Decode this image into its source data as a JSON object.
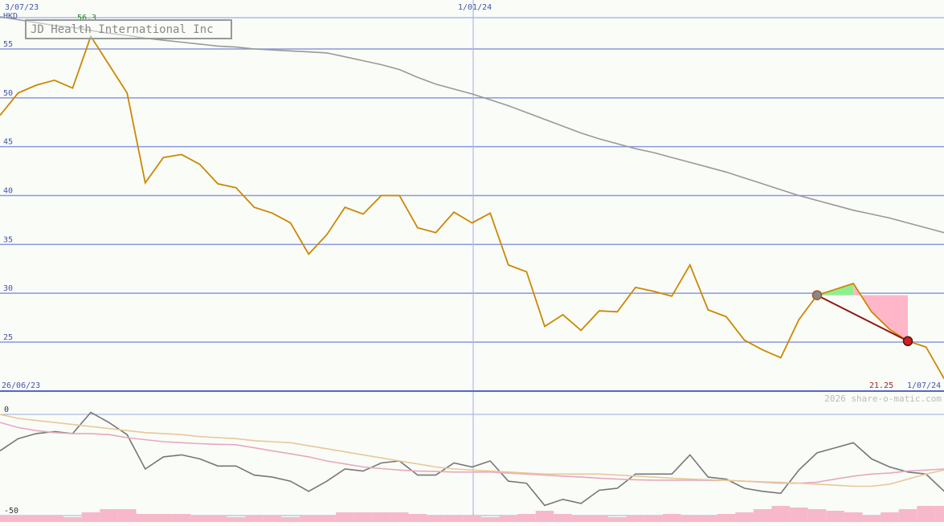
{
  "chart_data": [
    {
      "type": "line",
      "title": "JD Health International Inc",
      "currency_label": "HKD",
      "date_labels": {
        "top_left": "3/07/23",
        "top_mid": "1/01/24",
        "bottom_left": "26/06/23",
        "bottom_right": "1/07/24"
      },
      "y_ticks": [
        "25",
        "30",
        "35",
        "40",
        "45",
        "50",
        "55"
      ],
      "ylim": [
        20,
        58.5
      ],
      "grid": true,
      "max_label": "56.3",
      "min_label": "21.25",
      "x": [
        "2023-06-26",
        "2023-07-03",
        "2023-07-10",
        "2023-07-17",
        "2023-07-24",
        "2023-07-31",
        "2023-08-07",
        "2023-08-14",
        "2023-08-21",
        "2023-08-28",
        "2023-09-04",
        "2023-09-11",
        "2023-09-18",
        "2023-09-25",
        "2023-10-02",
        "2023-10-09",
        "2023-10-16",
        "2023-10-23",
        "2023-10-30",
        "2023-11-06",
        "2023-11-13",
        "2023-11-20",
        "2023-11-27",
        "2023-12-04",
        "2023-12-11",
        "2023-12-18",
        "2023-12-25",
        "2024-01-01",
        "2024-01-08",
        "2024-01-15",
        "2024-01-22",
        "2024-01-29",
        "2024-02-05",
        "2024-02-12",
        "2024-02-19",
        "2024-02-26",
        "2024-03-04",
        "2024-03-11",
        "2024-03-18",
        "2024-03-25",
        "2024-04-01",
        "2024-04-08",
        "2024-04-15",
        "2024-04-22",
        "2024-04-29",
        "2024-05-06",
        "2024-05-13",
        "2024-05-20",
        "2024-05-27",
        "2024-06-03",
        "2024-06-10",
        "2024-06-17",
        "2024-06-24",
        "2024-07-01"
      ],
      "series": [
        {
          "color": "#cc8800",
          "values": [
            48.2,
            50.5,
            51.3,
            51.8,
            51.0,
            56.3,
            53.4,
            50.5,
            41.3,
            43.9,
            44.2,
            43.2,
            41.2,
            40.8,
            38.8,
            38.2,
            37.2,
            34.0,
            36.0,
            38.8,
            38.1,
            40.0,
            40.0,
            36.7,
            36.2,
            38.3,
            37.2,
            38.2,
            32.9,
            32.2,
            26.6,
            27.8,
            26.2,
            28.2,
            28.1,
            30.6,
            30.2,
            29.7,
            32.9,
            28.3,
            27.6,
            25.2,
            24.2,
            23.4,
            27.3,
            29.8,
            30.4,
            31.0,
            28.1,
            26.3,
            25.1,
            24.5,
            21.25
          ]
        },
        {
          "color": "#999999",
          "values": [
            58.3,
            58.0,
            57.7,
            57.4,
            57.2,
            56.9,
            56.6,
            56.4,
            56.1,
            55.9,
            55.7,
            55.5,
            55.3,
            55.2,
            55.0,
            54.9,
            54.8,
            54.7,
            54.6,
            54.2,
            53.8,
            53.4,
            52.9,
            52.1,
            51.4,
            50.9,
            50.4,
            49.8,
            49.2,
            48.5,
            47.8,
            47.1,
            46.4,
            45.8,
            45.3,
            44.8,
            44.4,
            43.9,
            43.4,
            42.9,
            42.4,
            41.8,
            41.2,
            40.6,
            40.0,
            39.5,
            39.0,
            38.5,
            38.1,
            37.7,
            37.2,
            36.7,
            36.2,
            35.6
          ]
        }
      ],
      "trend": {
        "start_value": 29.8,
        "end_value": 25.1,
        "start_color": "#888888",
        "end_color": "#cc2222",
        "line_color": "#8b1a1a",
        "gain_fill": "#90ee90",
        "loss_fill": "#ffb6c8"
      },
      "watermark": "2026 share-o-matic.com"
    },
    {
      "type": "line",
      "title": "",
      "y_ticks": [
        "0",
        "-50"
      ],
      "ylim": [
        -50,
        0
      ],
      "series": [
        {
          "color": "#777777",
          "values": [
            -18,
            -12,
            -9.5,
            -8.5,
            -9.5,
            1,
            -4,
            -10,
            -27,
            -21,
            -20,
            -22,
            -25.5,
            -25.5,
            -30,
            -31,
            -33,
            -38,
            -33,
            -27,
            -28,
            -24,
            -23,
            -30,
            -30,
            -24,
            -26,
            -23,
            -33,
            -34,
            -45,
            -42,
            -44,
            -37.5,
            -36.5,
            -29.5,
            -29.5,
            -29.5,
            -20,
            -31,
            -32,
            -36.5,
            -38,
            -39,
            -27.5,
            -19,
            -16.5,
            -14,
            -22,
            -26,
            -28.5,
            -29.5,
            -38
          ]
        },
        {
          "color": "#e8a8c0",
          "values": [
            -4,
            -6.5,
            -8,
            -9,
            -9.5,
            -9.5,
            -10,
            -11.5,
            -12.5,
            -13.5,
            -14,
            -14.5,
            -14.8,
            -15,
            -16.5,
            -18,
            -19.5,
            -21,
            -23,
            -24.5,
            -26,
            -26.8,
            -27.5,
            -28,
            -28.2,
            -28.5,
            -28.5,
            -28.5,
            -29,
            -29.5,
            -30,
            -30.5,
            -31,
            -31.5,
            -32,
            -32.3,
            -32.5,
            -32.5,
            -32.5,
            -32.6,
            -32.6,
            -33,
            -33.5,
            -34,
            -34,
            -33.5,
            -32,
            -30.5,
            -29.5,
            -29,
            -28,
            -27.5,
            -27
          ]
        },
        {
          "color": "#e8c898",
          "values": [
            0,
            -2,
            -3,
            -4,
            -5,
            -6,
            -7,
            -8,
            -9,
            -9.5,
            -10,
            -11,
            -11.5,
            -12,
            -13,
            -13.5,
            -14,
            -15.5,
            -17,
            -18.5,
            -20,
            -21.5,
            -23,
            -24.5,
            -26,
            -27,
            -27.5,
            -28,
            -28.5,
            -29,
            -29.5,
            -29.5,
            -29.5,
            -29.5,
            -30,
            -30.5,
            -31,
            -31.5,
            -32,
            -32.3,
            -32.6,
            -33,
            -33.3,
            -33.6,
            -34,
            -34.5,
            -35,
            -35.5,
            -35.5,
            -34.5,
            -32,
            -29.5,
            -27.5
          ]
        }
      ],
      "volume_color": "#f7b8cb",
      "volume": [
        2,
        2,
        2,
        2,
        1.5,
        3,
        4,
        4,
        2.5,
        2.5,
        2.5,
        2,
        2,
        1.5,
        2,
        2,
        1.5,
        2,
        2,
        3,
        3,
        3,
        3,
        2.5,
        2,
        2,
        2,
        1.5,
        2,
        2.5,
        3.5,
        2.5,
        2,
        2,
        1.5,
        2,
        2,
        2.5,
        2,
        2,
        2.5,
        3,
        4,
        5,
        4.5,
        4,
        3.5,
        3,
        2,
        3,
        4,
        5,
        5
      ]
    }
  ]
}
